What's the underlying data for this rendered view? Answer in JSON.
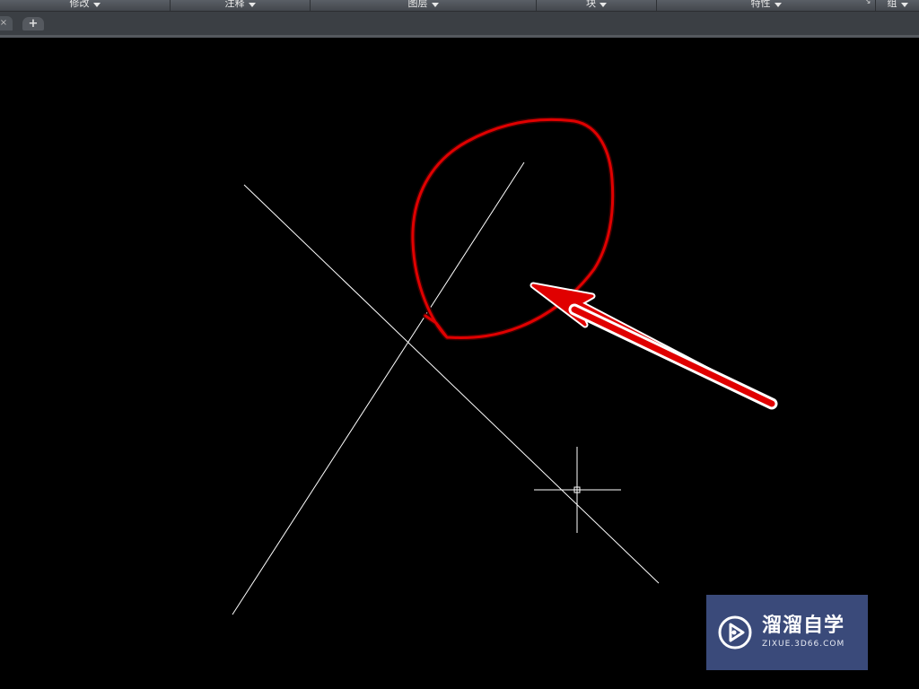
{
  "ribbon": {
    "panels": [
      {
        "label": "修改"
      },
      {
        "label": "注释"
      },
      {
        "label": "图层"
      },
      {
        "label": "块"
      },
      {
        "label": "特性"
      },
      {
        "label": "组"
      }
    ]
  },
  "tabs": {
    "close_glyph": "×",
    "new_tab_glyph": "+"
  },
  "canvas": {
    "background": "#000000",
    "line_color": "#ffffff",
    "annotation_color": "#e00000"
  },
  "watermark": {
    "title": "溜溜自学",
    "subtitle": "ZIXUE.3D66.COM",
    "bg_color": "#3a4a7a"
  }
}
